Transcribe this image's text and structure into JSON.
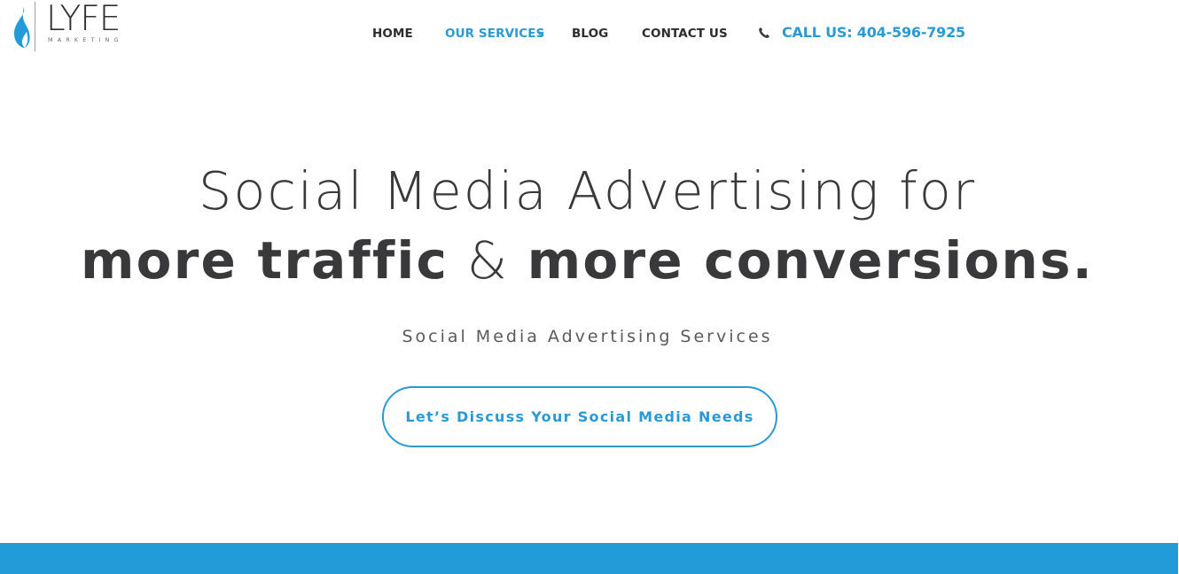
{
  "brand": {
    "logo_word": "LYFE",
    "logo_sub": "MARKETING",
    "accent_color": "#2b9ad3",
    "band_color": "#229bd8"
  },
  "nav": {
    "items": [
      {
        "label": "HOME",
        "active": false
      },
      {
        "label": "OUR SERVICES",
        "active": true,
        "has_dropdown": true
      },
      {
        "label": "BLOG",
        "active": false
      },
      {
        "label": "CONTACT US",
        "active": false
      }
    ],
    "dropdown_icon": "chevron-down-icon",
    "phone_icon": "phone-icon",
    "call_label": "CALL US: 404-596-7925"
  },
  "hero": {
    "line1": "Social Media Advertising for",
    "line2_part1": "more traffic",
    "line2_amp": "&",
    "line2_part2": "more conversions.",
    "subtitle": "Social Media Advertising Services",
    "cta_label": "Let’s Discuss Your Social Media Needs"
  }
}
